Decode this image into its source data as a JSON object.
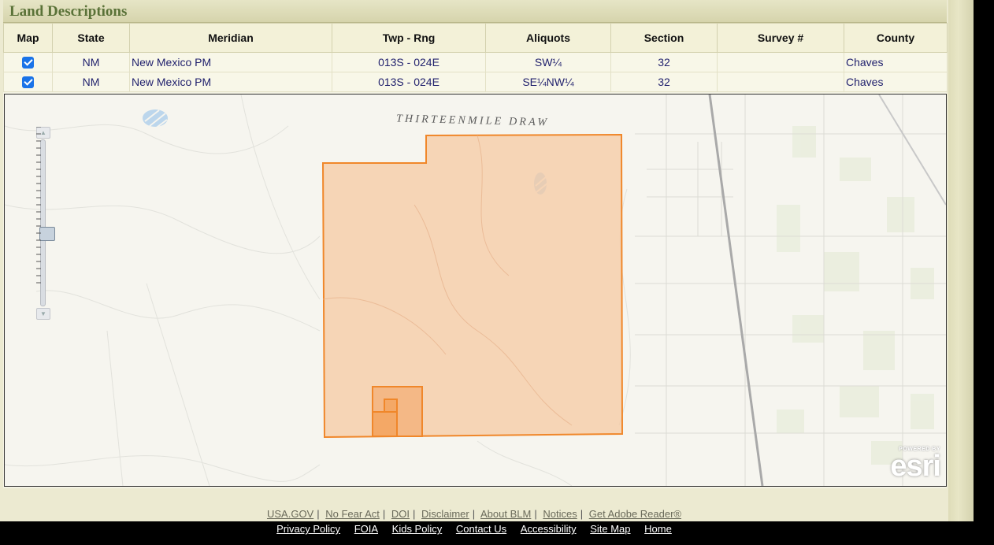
{
  "section": {
    "title": "Land Descriptions"
  },
  "table": {
    "headers": [
      "Map",
      "State",
      "Meridian",
      "Twp - Rng",
      "Aliquots",
      "Section",
      "Survey #",
      "County"
    ],
    "rows": [
      {
        "map_checked": true,
        "state": "NM",
        "meridian": "New Mexico PM",
        "twp_rng": "013S - 024E",
        "aliquots": "SW¼",
        "section": "32",
        "survey": "",
        "county": "Chaves"
      },
      {
        "map_checked": true,
        "state": "NM",
        "meridian": "New Mexico PM",
        "twp_rng": "013S - 024E",
        "aliquots": "SE¼NW¼",
        "section": "32",
        "survey": "",
        "county": "Chaves"
      }
    ]
  },
  "map": {
    "feature_label": "THIRTEENMILE DRAW",
    "attribution_powered": "POWERED BY",
    "attribution_logo": "esri",
    "highlight_color": "#f4a460",
    "highlight_stroke": "#f08a2a"
  },
  "footer": {
    "row1": [
      "USA.GOV",
      "No Fear Act",
      "DOI",
      "Disclaimer",
      "About BLM",
      "Notices",
      "Get Adobe Reader®"
    ],
    "row2": [
      "Privacy Policy",
      "FOIA",
      "Kids Policy",
      "Contact Us",
      "Accessibility",
      "Site Map",
      "Home"
    ]
  }
}
